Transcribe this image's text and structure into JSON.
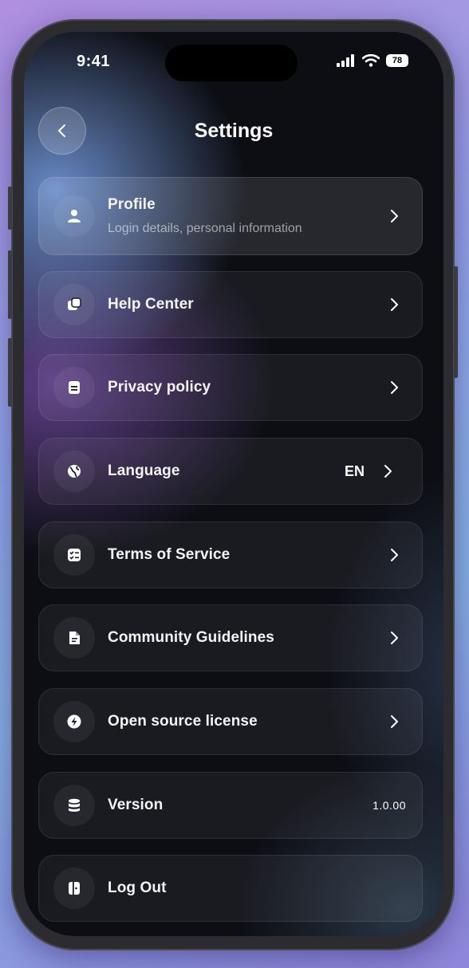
{
  "status_bar": {
    "time": "9:41",
    "battery": "78"
  },
  "header": {
    "title": "Settings"
  },
  "items": [
    {
      "label": "Profile",
      "subtitle": "Login details, personal information",
      "icon": "user-icon",
      "chevron": true
    },
    {
      "label": "Help Center",
      "icon": "help-center-icon",
      "chevron": true
    },
    {
      "label": "Privacy policy",
      "icon": "document-icon",
      "chevron": true
    },
    {
      "label": "Language",
      "value": "EN",
      "icon": "globe-icon",
      "chevron": true
    },
    {
      "label": "Terms of Service",
      "icon": "checklist-icon",
      "chevron": true
    },
    {
      "label": "Community Guidelines",
      "icon": "file-icon",
      "chevron": true
    },
    {
      "label": "Open source license",
      "icon": "bolt-icon",
      "chevron": true
    },
    {
      "label": "Version",
      "value": "1.0.00",
      "icon": "database-icon",
      "chevron": false
    },
    {
      "label": "Log Out",
      "icon": "logout-icon",
      "chevron": false
    }
  ]
}
